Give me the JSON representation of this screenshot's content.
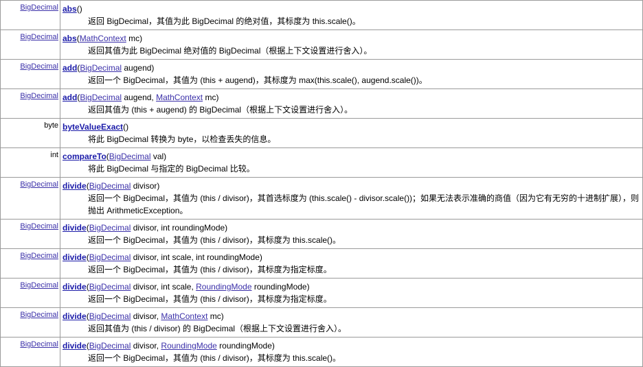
{
  "rows": [
    {
      "ret": "BigDecimal",
      "ret_link": true,
      "method": "abs",
      "params": [],
      "desc": "返回 BigDecimal，其值为此 BigDecimal 的绝对值，其标度为 this.scale()。"
    },
    {
      "ret": "BigDecimal",
      "ret_link": true,
      "method": "abs",
      "params": [
        {
          "type": "MathContext",
          "link": true,
          "name": "mc"
        }
      ],
      "desc": "返回其值为此 BigDecimal 绝对值的 BigDecimal（根据上下文设置进行舍入）。"
    },
    {
      "ret": "BigDecimal",
      "ret_link": true,
      "method": "add",
      "params": [
        {
          "type": "BigDecimal",
          "link": true,
          "name": "augend"
        }
      ],
      "desc": "返回一个 BigDecimal，其值为 (this + augend)，其标度为 max(this.scale(), augend.scale())。"
    },
    {
      "ret": "BigDecimal",
      "ret_link": true,
      "method": "add",
      "params": [
        {
          "type": "BigDecimal",
          "link": true,
          "name": "augend"
        },
        {
          "type": "MathContext",
          "link": true,
          "name": "mc"
        }
      ],
      "desc": "返回其值为 (this + augend) 的 BigDecimal（根据上下文设置进行舍入）。"
    },
    {
      "ret": "byte",
      "ret_link": false,
      "method": "byteValueExact",
      "params": [],
      "desc": "将此 BigDecimal 转换为 byte，以检查丢失的信息。"
    },
    {
      "ret": "int",
      "ret_link": false,
      "method": "compareTo",
      "params": [
        {
          "type": "BigDecimal",
          "link": true,
          "name": "val"
        }
      ],
      "desc": "将此 BigDecimal 与指定的 BigDecimal 比较。"
    },
    {
      "ret": "BigDecimal",
      "ret_link": true,
      "method": "divide",
      "params": [
        {
          "type": "BigDecimal",
          "link": true,
          "name": "divisor"
        }
      ],
      "desc": "返回一个 BigDecimal，其值为 (this / divisor)，其首选标度为 (this.scale() - divisor.scale())；如果无法表示准确的商值（因为它有无穷的十进制扩展），则抛出 ArithmeticException。"
    },
    {
      "ret": "BigDecimal",
      "ret_link": true,
      "method": "divide",
      "params": [
        {
          "type": "BigDecimal",
          "link": true,
          "name": "divisor"
        },
        {
          "type": "int",
          "link": false,
          "name": "roundingMode"
        }
      ],
      "desc": "返回一个 BigDecimal，其值为 (this / divisor)，其标度为 this.scale()。"
    },
    {
      "ret": "BigDecimal",
      "ret_link": true,
      "method": "divide",
      "params": [
        {
          "type": "BigDecimal",
          "link": true,
          "name": "divisor"
        },
        {
          "type": "int",
          "link": false,
          "name": "scale"
        },
        {
          "type": "int",
          "link": false,
          "name": "roundingMode"
        }
      ],
      "desc": "返回一个 BigDecimal，其值为 (this / divisor)，其标度为指定标度。"
    },
    {
      "ret": "BigDecimal",
      "ret_link": true,
      "method": "divide",
      "params": [
        {
          "type": "BigDecimal",
          "link": true,
          "name": "divisor"
        },
        {
          "type": "int",
          "link": false,
          "name": "scale"
        },
        {
          "type": "RoundingMode",
          "link": true,
          "name": "roundingMode"
        }
      ],
      "desc": "返回一个 BigDecimal，其值为 (this / divisor)，其标度为指定标度。"
    },
    {
      "ret": "BigDecimal",
      "ret_link": true,
      "method": "divide",
      "params": [
        {
          "type": "BigDecimal",
          "link": true,
          "name": "divisor"
        },
        {
          "type": "MathContext",
          "link": true,
          "name": "mc"
        }
      ],
      "desc": "返回其值为 (this / divisor) 的 BigDecimal（根据上下文设置进行舍入）。"
    },
    {
      "ret": "BigDecimal",
      "ret_link": true,
      "method": "divide",
      "params": [
        {
          "type": "BigDecimal",
          "link": true,
          "name": "divisor"
        },
        {
          "type": "RoundingMode",
          "link": true,
          "name": "roundingMode"
        }
      ],
      "desc": "返回一个 BigDecimal，其值为 (this / divisor)，其标度为 this.scale()。"
    }
  ]
}
